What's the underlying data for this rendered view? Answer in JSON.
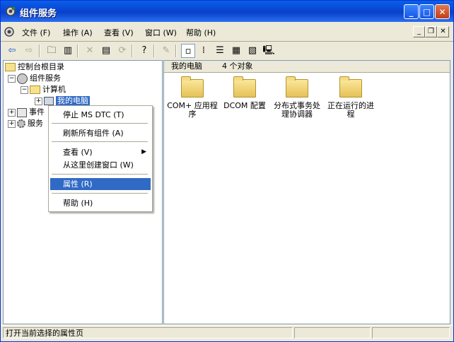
{
  "window": {
    "title": "组件服务"
  },
  "menubar": {
    "items": [
      "文件 (F)",
      "操作 (A)",
      "查看 (V)",
      "窗口 (W)",
      "帮助 (H)"
    ]
  },
  "tree": {
    "root": "控制台根目录",
    "component_services": "组件服务",
    "computers": "计算机",
    "my_computer": "我的电脑",
    "event_viewer": "事件",
    "services": "服务"
  },
  "list": {
    "header_location": "我的电脑",
    "header_count": "4 个对象",
    "items": [
      {
        "label": "COM+ 应用程序"
      },
      {
        "label": "DCOM 配置"
      },
      {
        "label": "分布式事务处理协调器"
      },
      {
        "label": "正在运行的进程"
      }
    ]
  },
  "context_menu": {
    "items": [
      {
        "label": "停止 MS DTC (T)"
      },
      {
        "label": "刷新所有组件 (A)"
      },
      {
        "label": "查看 (V)"
      },
      {
        "label": "从这里创建窗口 (W)"
      },
      {
        "label": "属性 (R)"
      },
      {
        "label": "帮助 (H)"
      }
    ]
  },
  "status": {
    "text": "打开当前选择的属性页"
  }
}
